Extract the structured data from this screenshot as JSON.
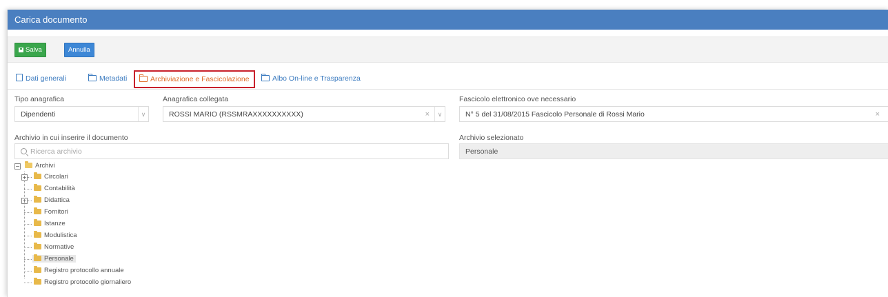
{
  "window": {
    "title": "Carica documento"
  },
  "toolbar": {
    "save_label": "Salva",
    "cancel_label": "Annulla"
  },
  "tabs": [
    {
      "label": "Dati generali",
      "icon": "document-icon"
    },
    {
      "label": "Metadati",
      "icon": "folder-icon"
    },
    {
      "label": "Archiviazione e Fascicolazione",
      "icon": "folder-icon",
      "active": true
    },
    {
      "label": "Albo On-line e Trasparenza",
      "icon": "folder-icon"
    }
  ],
  "form": {
    "tipo_anagrafica": {
      "label": "Tipo anagrafica",
      "value": "Dipendenti"
    },
    "anagrafica_collegata": {
      "label": "Anagrafica collegata",
      "value": "ROSSI MARIO (RSSMRAXXXXXXXXXX)",
      "clear": "×"
    },
    "fascicolo": {
      "label": "Fascicolo elettronico ove necessario",
      "value": "N° 5 del 31/08/2015  Fascicolo Personale di Rossi Mario",
      "clear": "×"
    },
    "archivio": {
      "label": "Archivio in cui inserire il documento",
      "placeholder": "Ricerca archivio"
    },
    "archivio_selezionato": {
      "label": "Archivio selezionato",
      "value": "Personale"
    }
  },
  "tree": {
    "root": "Archivi",
    "items": [
      {
        "label": "Circolari",
        "expandable": true
      },
      {
        "label": "Contabilità",
        "expandable": false
      },
      {
        "label": "Didattica",
        "expandable": true
      },
      {
        "label": "Fornitori",
        "expandable": false
      },
      {
        "label": "Istanze",
        "expandable": false
      },
      {
        "label": "Modulistica",
        "expandable": false
      },
      {
        "label": "Normative",
        "expandable": false
      },
      {
        "label": "Personale",
        "expandable": false,
        "selected": true
      },
      {
        "label": "Registro protocollo annuale",
        "expandable": false
      },
      {
        "label": "Registro protocollo giornaliero",
        "expandable": false
      }
    ]
  },
  "colors": {
    "titlebar": "#4a7fc0",
    "save_button": "#3aa64c",
    "cancel_button": "#3d87d6",
    "tab_link": "#3d7cc0",
    "active_tab_text": "#e06d2a",
    "active_tab_border": "#c8202b",
    "folder": "#e8b94a"
  }
}
